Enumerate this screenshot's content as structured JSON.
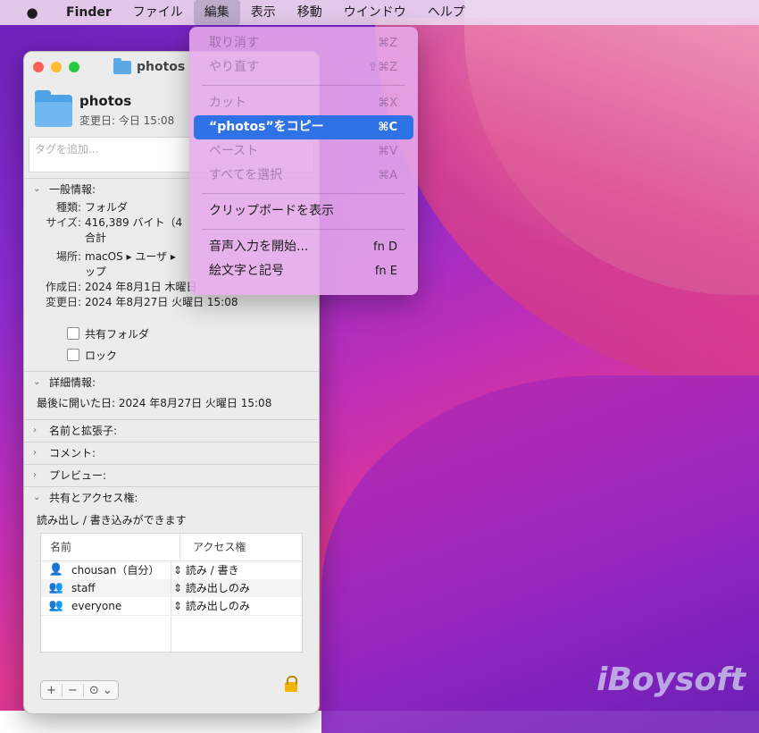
{
  "menubar": {
    "apple": "",
    "items": [
      "Finder",
      "ファイル",
      "編集",
      "表示",
      "移動",
      "ウインドウ",
      "ヘルプ"
    ]
  },
  "window": {
    "title": "photos",
    "folder_name": "photos",
    "modified": "変更日: 今日 15:08",
    "tags_placeholder": "タグを追加...",
    "general": {
      "header": "一般情報:",
      "kind_k": "種類:",
      "kind_v": "フォルダ",
      "size_k": "サイズ:",
      "size_v": "416,389 バイト（4",
      "size_v2": "合計",
      "where_k": "場所:",
      "where_v": "macOS ▸ ユーザ ▸",
      "where_v2": "ップ",
      "created_k": "作成日:",
      "created_v": "2024 年8月1日 木曜日",
      "modified_k": "変更日:",
      "modified_v": "2024 年8月27日 火曜日 15:08",
      "shared_folder": "共有フォルダ",
      "locked": "ロック"
    },
    "more": {
      "header": "詳細情報:",
      "last_opened": "最後に開いた日: 2024 年8月27日 火曜日 15:08"
    },
    "name_ext": "名前と拡張子:",
    "comments": "コメント:",
    "preview": "プレビュー:",
    "sharing": {
      "header": "共有とアクセス権:",
      "status": "読み出し / 書き込みができます",
      "col_name": "名前",
      "col_access": "アクセス権",
      "rows": [
        {
          "icon": "👤",
          "name": "chousan（自分）",
          "access": "⇕ 読み / 書き"
        },
        {
          "icon": "👥",
          "name": "staff",
          "access": "⇕ 読み出しのみ"
        },
        {
          "icon": "👥",
          "name": "everyone",
          "access": "⇕ 読み出しのみ"
        }
      ]
    },
    "bottom": {
      "add": "+",
      "remove": "−",
      "action": "⊙ ⌄"
    }
  },
  "edit_menu": {
    "items": [
      {
        "label": "取り消す",
        "shortcut": "⌘Z",
        "state": "disabled"
      },
      {
        "label": "やり直す",
        "shortcut": "⇧⌘Z",
        "state": "disabled"
      },
      {
        "label": "カット",
        "shortcut": "⌘X",
        "state": "disabled"
      },
      {
        "label": "“photos”をコピー",
        "shortcut": "⌘C",
        "state": "selected"
      },
      {
        "label": "ペースト",
        "shortcut": "⌘V",
        "state": "disabled"
      },
      {
        "label": "すべてを選択",
        "shortcut": "⌘A",
        "state": "disabled"
      },
      {
        "label": "クリップボードを表示",
        "shortcut": "",
        "state": "enabled"
      },
      {
        "label": "音声入力を開始...",
        "shortcut": "fn D",
        "state": "enabled"
      },
      {
        "label": "絵文字と記号",
        "shortcut": "fn E",
        "state": "enabled"
      }
    ]
  },
  "watermark": "iBoysoft"
}
